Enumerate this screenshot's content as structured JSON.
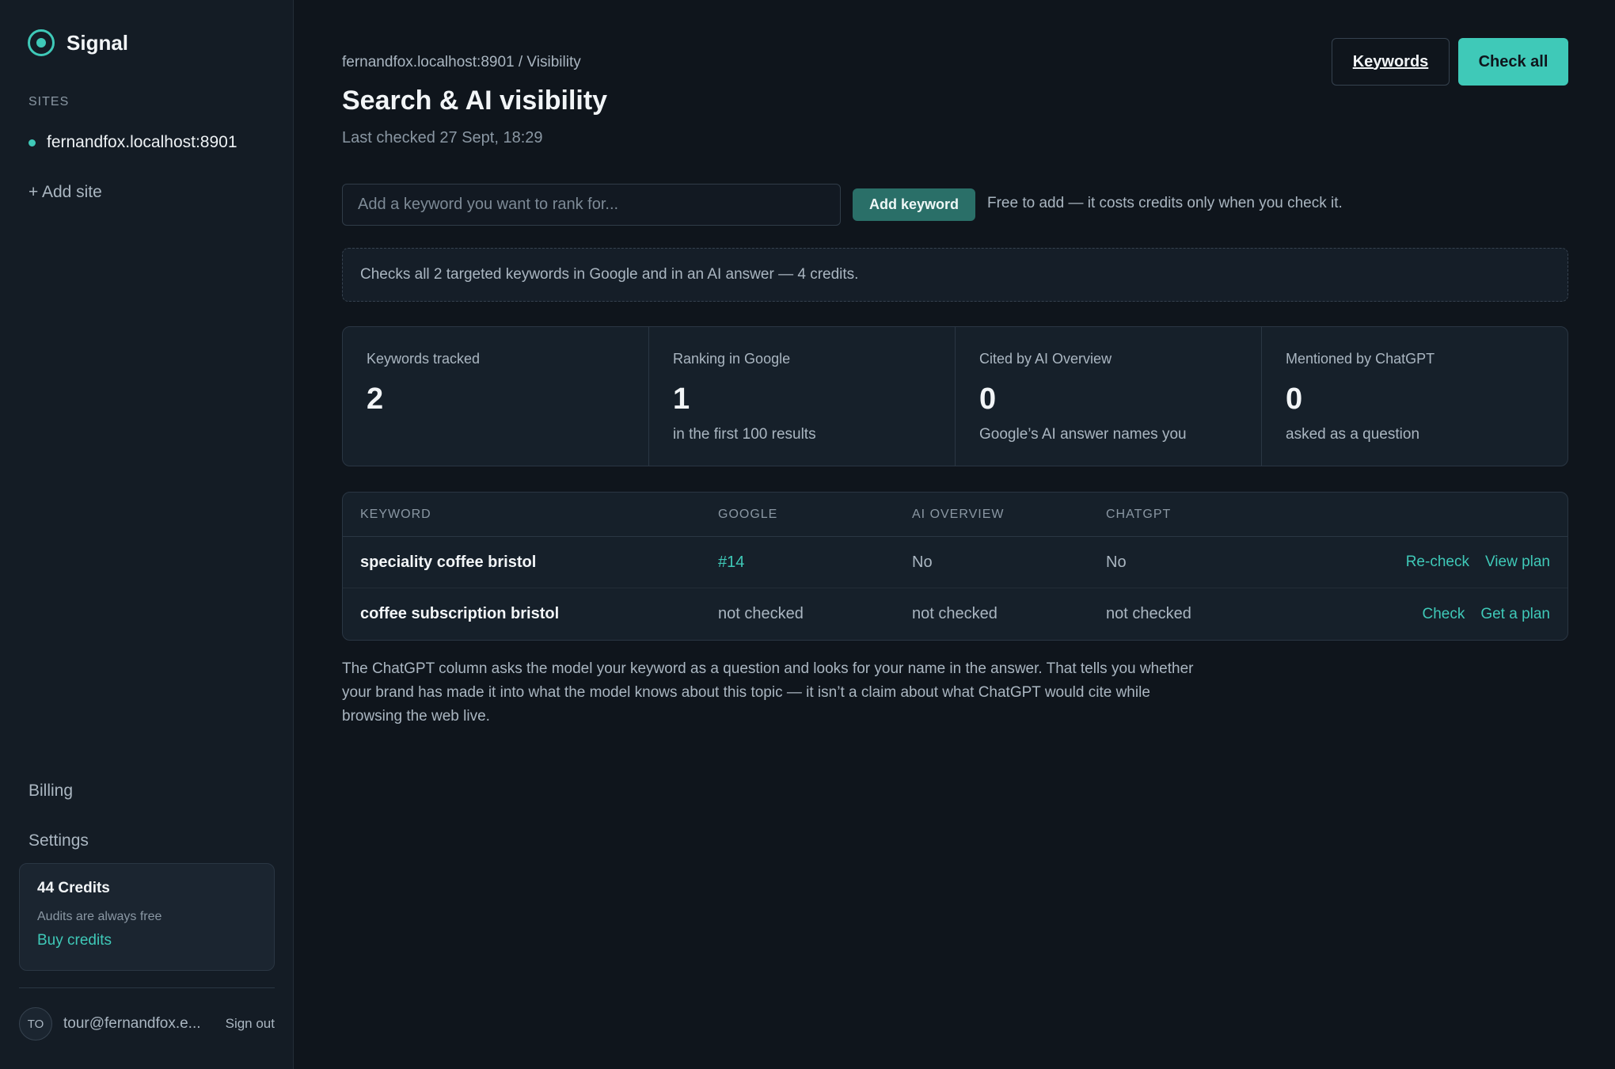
{
  "app": {
    "name": "Signal"
  },
  "sidebar": {
    "sites_label": "SITES",
    "sites": [
      {
        "label": "fernandfox.localhost:8901"
      }
    ],
    "add_site": "+ Add site",
    "billing": "Billing",
    "settings": "Settings",
    "credits": {
      "title": "44 Credits",
      "subtitle": "Audits are always free",
      "buy": "Buy credits"
    },
    "user": {
      "initials": "TO",
      "email": "tour@fernandfox.e...",
      "sign_out": "Sign out"
    }
  },
  "header": {
    "breadcrumb": "fernandfox.localhost:8901 / Visibility",
    "title": "Search & AI visibility",
    "last_checked": "Last checked 27 Sept, 18:29",
    "keywords_button": "Keywords",
    "check_all_button": "Check all"
  },
  "add_keyword": {
    "placeholder": "Add a keyword you want to rank for...",
    "button": "Add keyword",
    "note": "Free to add — it costs credits only when you check it."
  },
  "banner": "Checks all 2 targeted keywords in Google and in an AI answer — 4 credits.",
  "stats": [
    {
      "label": "Keywords tracked",
      "value": "2",
      "sub": ""
    },
    {
      "label": "Ranking in Google",
      "value": "1",
      "sub": "in the first 100 results"
    },
    {
      "label": "Cited by AI Overview",
      "value": "0",
      "sub": "Google’s AI answer names you"
    },
    {
      "label": "Mentioned by ChatGPT",
      "value": "0",
      "sub": "asked as a question"
    }
  ],
  "table": {
    "headers": [
      "KEYWORD",
      "GOOGLE",
      "AI OVERVIEW",
      "CHATGPT"
    ],
    "rows": [
      {
        "keyword": "speciality coffee bristol",
        "google": "#14",
        "ai_overview": "No",
        "chatgpt": "No",
        "action1": "Re-check",
        "action2": "View plan"
      },
      {
        "keyword": "coffee subscription bristol",
        "google": "not checked",
        "ai_overview": "not checked",
        "chatgpt": "not checked",
        "action1": "Check",
        "action2": "Get a plan"
      }
    ]
  },
  "footnote": "The ChatGPT column asks the model your keyword as a question and looks for your name in the answer. That tells you whether your brand has made it into what the model knows about this topic — it isn’t a claim about what ChatGPT would cite while browsing the web live.",
  "colors": {
    "accent": "#3fc9b8",
    "background": "#0f151c",
    "sidebar": "#141c25"
  }
}
